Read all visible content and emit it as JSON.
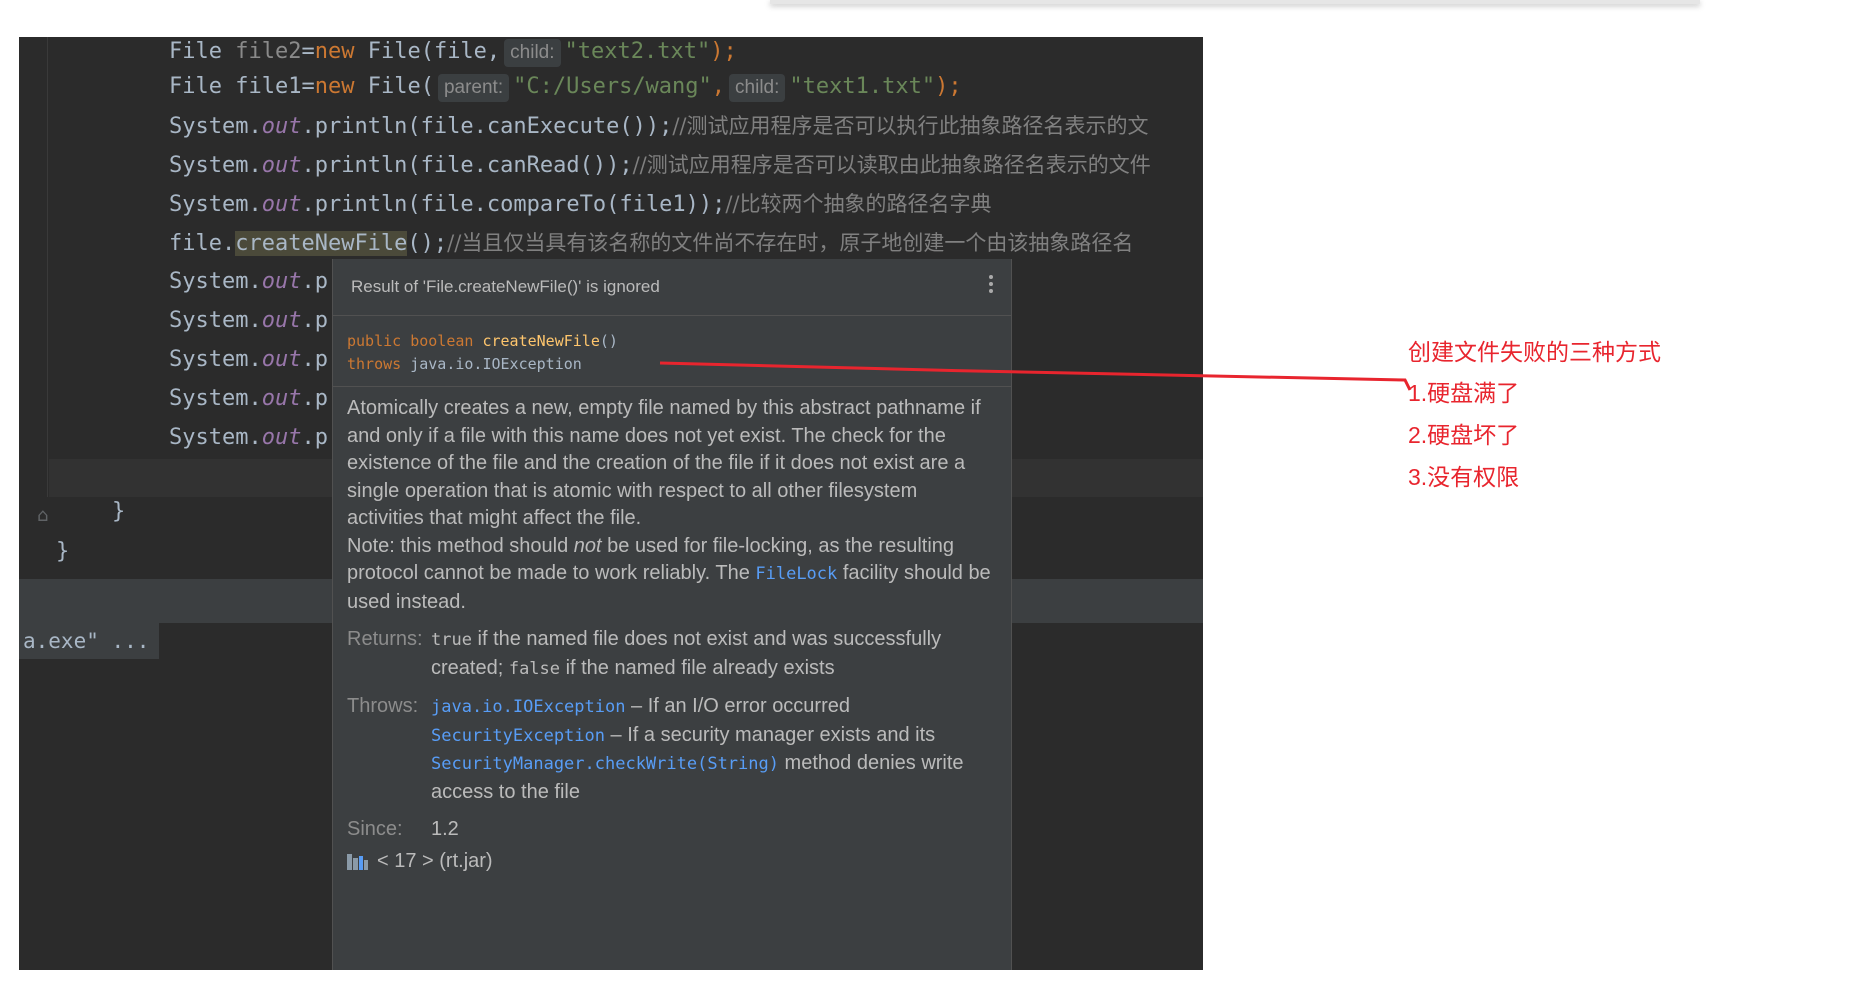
{
  "code": {
    "l1": {
      "type": "File",
      "name": "file2",
      "eq": "=",
      "new": "new",
      "ctor": "File(file,",
      "hint": "child:",
      "arg": "\"text2.txt\"",
      "end": ");"
    },
    "l2": {
      "type": "File",
      "name": "file1",
      "eq": "=",
      "new": "new",
      "ctor": "File(",
      "hint1": "parent:",
      "arg1": "\"C:/Users/wang\"",
      "comma": ",",
      "hint2": "child:",
      "arg2": "\"text1.txt\"",
      "end": ");"
    },
    "l3": {
      "cls": "System.",
      "fld": "out",
      "call": ".println(file.canExecute());",
      "cmt": "//测试应用程序是否可以执行此抽象路径名表示的文"
    },
    "l4": {
      "cls": "System.",
      "fld": "out",
      "call": ".println(file.canRead());",
      "cmt": "//测试应用程序是否可以读取由此抽象路径名表示的文件"
    },
    "l5": {
      "cls": "System.",
      "fld": "out",
      "call": ".println(file.compareTo(file1));",
      "cmt": "//比较两个抽象的路径名字典"
    },
    "l6": {
      "obj": "file.",
      "method": "createNewFile",
      "rest": "();",
      "cmt": "//当且仅当具有该名称的文件尚不存在时，原子地创建一个由该抽象路径名"
    },
    "stub": {
      "cls": "System.",
      "fld": "out",
      "tail": ".p"
    },
    "brace_inner": "}",
    "brace_outer": "}",
    "console": "a.exe\" ..."
  },
  "popup": {
    "title": "Result of 'File.createNewFile()' is ignored",
    "sig_public": "public",
    "sig_boolean": "boolean",
    "sig_method": "createNewFile",
    "sig_parens": "()",
    "sig_throws": "throws",
    "sig_exc": "java.io.IOException",
    "desc1": "Atomically creates a new, empty file named by this abstract pathname if and only if a file with this name does not yet exist. The check for the existence of the file and the creation of the file if it does not exist are a single operation that is atomic with respect to all other filesystem activities that might affect the file.",
    "note_pre": "Note: this method should ",
    "note_em": "not",
    "note_mid": " be used for file-locking, as the resulting protocol cannot be made to work reliably. The ",
    "note_link": "FileLock",
    "note_post": " facility should be used instead.",
    "returns_label": "Returns:",
    "returns_true": "true",
    "returns_mid": " if the named file does not exist and was successfully created; ",
    "returns_false": "false",
    "returns_end": " if the named file already exists",
    "throws_label": "Throws:",
    "throws_exc1": "java.io.IOException",
    "throws_text1": " – If an I/O error occurred",
    "throws_exc2": "SecurityException",
    "throws_text2": " – If a security manager exists and its ",
    "throws_exc3": "SecurityManager.checkWrite(String)",
    "throws_text3": " method denies write access to the file",
    "since_label": "Since:",
    "since_value": "1.2",
    "lib": "< 17 > (rt.jar)"
  },
  "annotation": {
    "title": "创建文件失败的三种方式",
    "items": [
      "1.硬盘满了",
      "2.硬盘坏了",
      "3.没有权限"
    ],
    "color": "#e8252e"
  }
}
